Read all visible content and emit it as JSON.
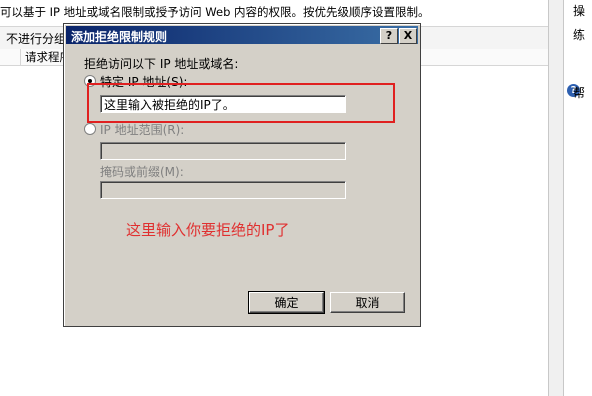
{
  "background": {
    "description": "可以基于 IP 地址或域名限制或授予访问 Web 内容的权限。按优先级顺序设置限制。",
    "toolbar_label": "不进行分组",
    "column_header": "请求程序",
    "right_panel": [
      "操",
      "练",
      "帮"
    ]
  },
  "dialog": {
    "title": "添加拒绝限制规则",
    "help_button": "?",
    "close_button": "X",
    "prompt": "拒绝访问以下 IP 地址或域名:",
    "specific_ip_label": "特定 IP 地址(S):",
    "specific_ip_value": "这里输入被拒绝的IP了。",
    "ip_range_label": "IP 地址范围(R):",
    "mask_label": "掩码或前缀(M):",
    "ok_button": "确定",
    "cancel_button": "取消"
  },
  "annotation": {
    "text": "这里输入你要拒绝的IP了",
    "color": "#e02020"
  }
}
